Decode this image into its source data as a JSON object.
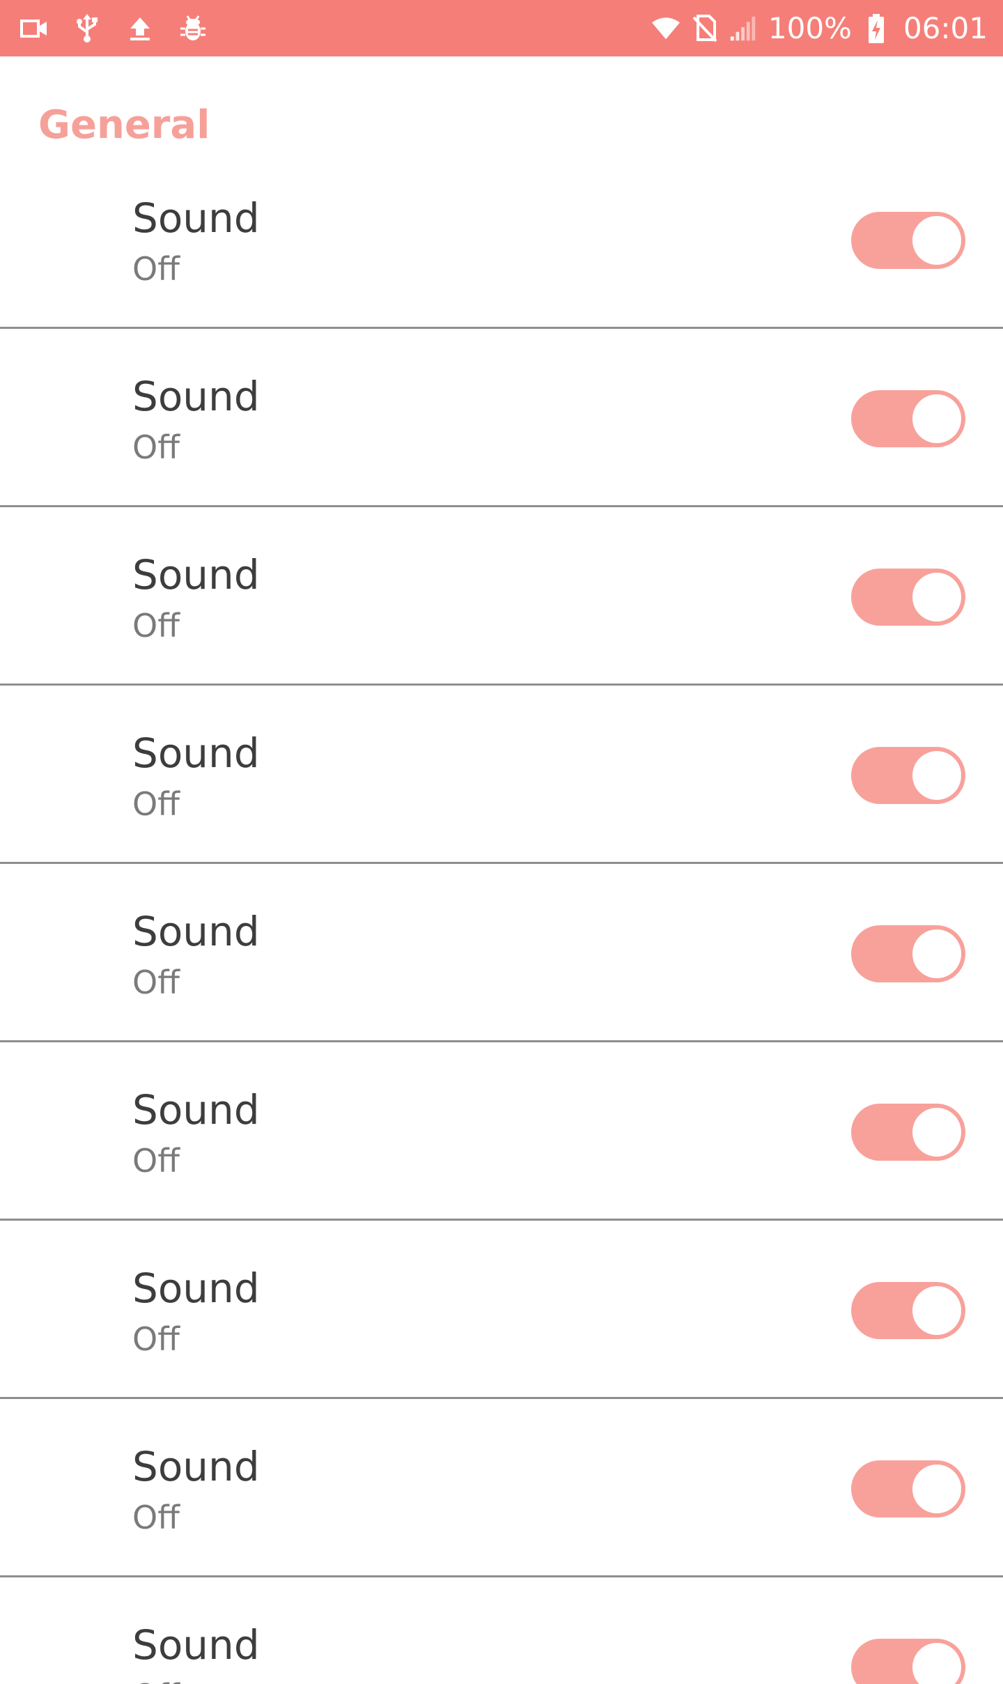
{
  "status_bar": {
    "left_icons": [
      "video-camera-icon",
      "usb-icon",
      "upload-icon",
      "android-debug-icon"
    ],
    "right_icons": [
      "wifi-icon",
      "no-sim-icon",
      "signal-icon",
      "battery-charging-icon"
    ],
    "battery_percent": "100%",
    "time": "06:01",
    "color": "#f57f78"
  },
  "section": {
    "title": "General",
    "accent_color": "#f6a09a"
  },
  "settings": [
    {
      "title": "Sound",
      "summary": "Off",
      "switch_on": true
    },
    {
      "title": "Sound",
      "summary": "Off",
      "switch_on": true
    },
    {
      "title": "Sound",
      "summary": "Off",
      "switch_on": true
    },
    {
      "title": "Sound",
      "summary": "Off",
      "switch_on": true
    },
    {
      "title": "Sound",
      "summary": "Off",
      "switch_on": true
    },
    {
      "title": "Sound",
      "summary": "Off",
      "switch_on": true
    },
    {
      "title": "Sound",
      "summary": "Off",
      "switch_on": true
    },
    {
      "title": "Sound",
      "summary": "Off",
      "switch_on": true
    },
    {
      "title": "Sound",
      "summary": "Off",
      "switch_on": true
    }
  ]
}
